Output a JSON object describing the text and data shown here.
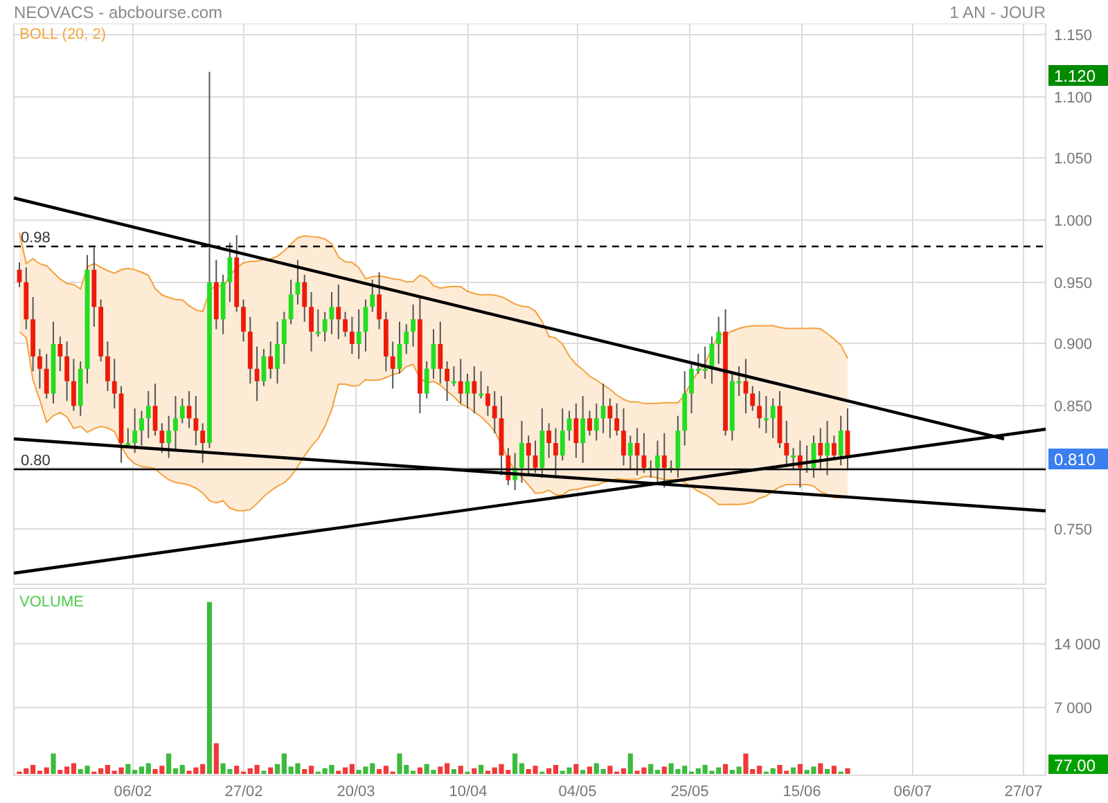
{
  "header": {
    "title": "NEOVACS - abcbourse.com",
    "period": "1 AN - JOUR"
  },
  "price_panel": {
    "legend": "BOLL (20, 2)",
    "axis_ticks": [
      "1.150",
      "1.100",
      "1.050",
      "1.000",
      "0.950",
      "0.900",
      "0.850",
      "0.750"
    ],
    "high_badge": "1.120",
    "last_badge": "0.810",
    "levels": [
      {
        "label": "0.98",
        "kind": "dashed"
      },
      {
        "label": "0.80",
        "kind": "solid"
      }
    ]
  },
  "volume_panel": {
    "legend": "VOLUME",
    "axis_ticks": [
      "14 000",
      "7 000"
    ],
    "last_badge": "77.00"
  },
  "date_axis": [
    "06/02",
    "27/02",
    "20/03",
    "10/04",
    "04/05",
    "25/05",
    "15/06",
    "06/07",
    "27/07"
  ]
}
